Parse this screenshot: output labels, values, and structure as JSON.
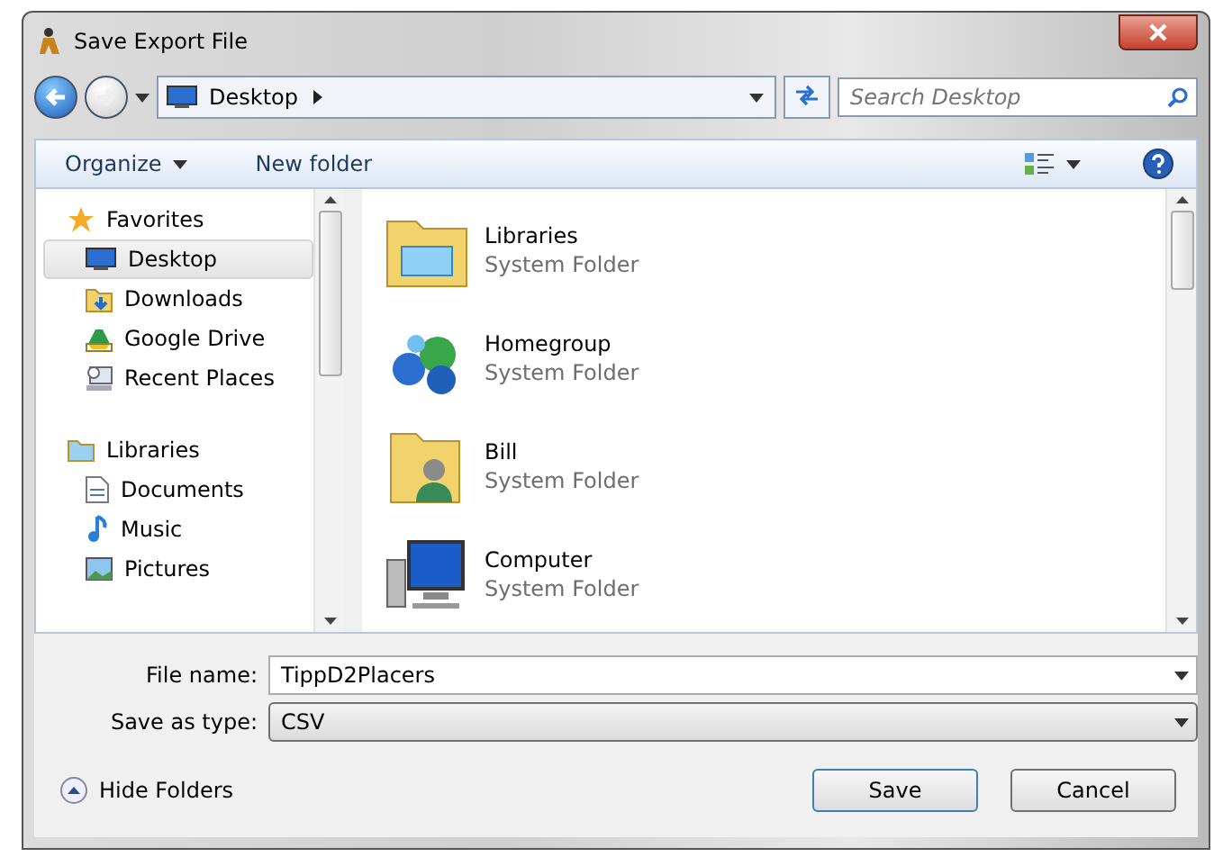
{
  "window": {
    "title": "Save Export File"
  },
  "address": {
    "location": "Desktop",
    "search_placeholder": "Search Desktop"
  },
  "toolbar": {
    "organize": "Organize",
    "new_folder": "New folder"
  },
  "navigation": [
    {
      "label": "Favorites",
      "children": [
        {
          "label": "Desktop",
          "selected": true
        },
        {
          "label": "Downloads",
          "selected": false
        },
        {
          "label": "Google Drive",
          "selected": false
        },
        {
          "label": "Recent Places",
          "selected": false
        }
      ]
    },
    {
      "label": "Libraries",
      "children": [
        {
          "label": "Documents",
          "selected": false
        },
        {
          "label": "Music",
          "selected": false
        },
        {
          "label": "Pictures",
          "selected": false
        }
      ]
    }
  ],
  "files": [
    {
      "name": "Libraries",
      "type": "System Folder"
    },
    {
      "name": "Homegroup",
      "type": "System Folder"
    },
    {
      "name": "Bill",
      "type": "System Folder"
    },
    {
      "name": "Computer",
      "type": "System Folder"
    }
  ],
  "form": {
    "file_name_label": "File name:",
    "file_name": "TippD2Placers",
    "type_label": "Save as type:",
    "type": "CSV"
  },
  "footer": {
    "hide_folders": "Hide Folders",
    "save": "Save",
    "cancel": "Cancel"
  }
}
